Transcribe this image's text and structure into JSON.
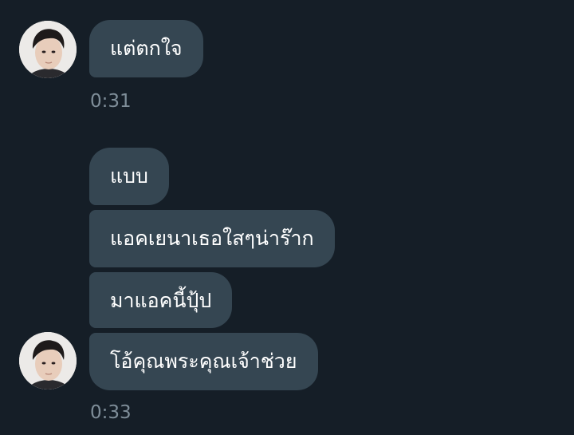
{
  "colors": {
    "background": "#151e27",
    "bubble": "#354652",
    "bubble_text": "#ffffff",
    "timestamp": "#7f8e99"
  },
  "groups": [
    {
      "avatar_icon": "contact-avatar-photo",
      "messages": [
        "แต่ตกใจ"
      ],
      "time": "0:31"
    },
    {
      "avatar_icon": "contact-avatar-photo",
      "messages": [
        "แบบ",
        "แอคเยนาเธอใสๆน่าร๊าก",
        "มาแอคนี้ปุ้ป",
        "โอ้คุณพระคุณเจ้าช่วย"
      ],
      "time": "0:33"
    }
  ]
}
